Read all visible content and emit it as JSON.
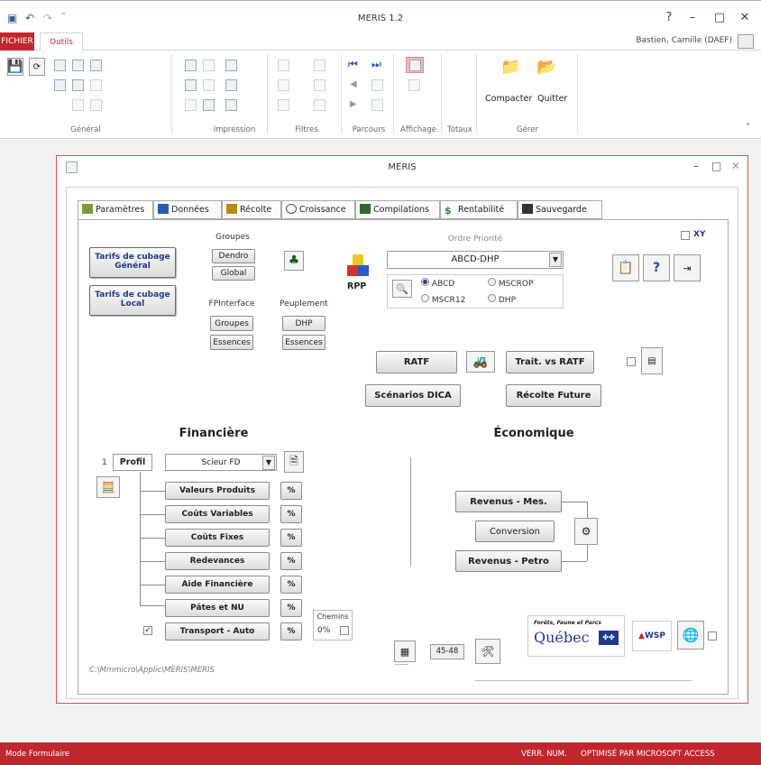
{
  "titlebar": {
    "title": "MERIS 1.2",
    "help": "?",
    "minimize": "–",
    "maximize": "□",
    "close": "✕"
  },
  "ribbon": {
    "tabs": {
      "fichier": "FICHIER",
      "outils": "Outils"
    },
    "user": "Bastien, Camille (DAEF)",
    "groups": {
      "general": "Général",
      "impression": "Impression",
      "filtres": "Filtres",
      "parcours": "Parcours",
      "affichage": "Affichage",
      "totaux": "Totaux",
      "gerer": "Gérer"
    },
    "compacter": "Compacter",
    "quitter": "Quitter"
  },
  "form": {
    "title": "MERIS",
    "tabs": [
      "Paramètres",
      "Données",
      "Récolte",
      "Croissance",
      "Compilations",
      "Rentabilité",
      "Sauvegarde"
    ],
    "xy_label": "XY",
    "tarifs_general": "Tarifs de cubage Général",
    "tarifs_local": "Tarifs de cubage Local",
    "groupes_label": "Groupes",
    "dendro": "Dendro",
    "global": "Global",
    "fpinterface_label": "FPInterface",
    "peuplement_label": "Peuplement",
    "groupes_btn": "Groupes",
    "essences_btn": "Essences",
    "dhp_btn": "DHP",
    "essences2_btn": "Essences",
    "rpp": "RPP",
    "ordre_priorite": "Ordre Priorité",
    "ordre_value": "ABCD-DHP",
    "radios": [
      "ABCD",
      "MSCROP",
      "MSCR12",
      "DHP"
    ],
    "ratf": "RATF",
    "trait_vs_ratf": "Trait. vs RATF",
    "scenarios_dica": "Scénarios DICA",
    "recolte_future": "Récolte Future",
    "financiere": "Financière",
    "economique": "Économique",
    "profil_num": "1",
    "profil": "Profil",
    "profil_value": "Scieur FD",
    "fin_buttons": [
      "Valeurs Produits",
      "Coûts Variables",
      "Coûts Fixes",
      "Redevances",
      "Aide Financière",
      "Pâtes et NU",
      "Transport - Auto"
    ],
    "pct": "%",
    "chemins_label": "Chemins",
    "chemins_value": "0%",
    "revenus_mes": "Revenus - Mes.",
    "conversion": "Conversion",
    "revenus_petro": "Revenus - Petro",
    "range_value": "45-48",
    "path": "C:\\Mmmicro\\Applic\\MERIS\\MERIS",
    "quebec_small": "Forêts, Faune et Parcs",
    "quebec": "Québec",
    "wsp": "WSP"
  },
  "status": {
    "mode": "Mode Formulaire",
    "verr": "VERR. NUM.",
    "optimise": "OPTIMISÉ PAR MICROSOFT ACCESS"
  }
}
